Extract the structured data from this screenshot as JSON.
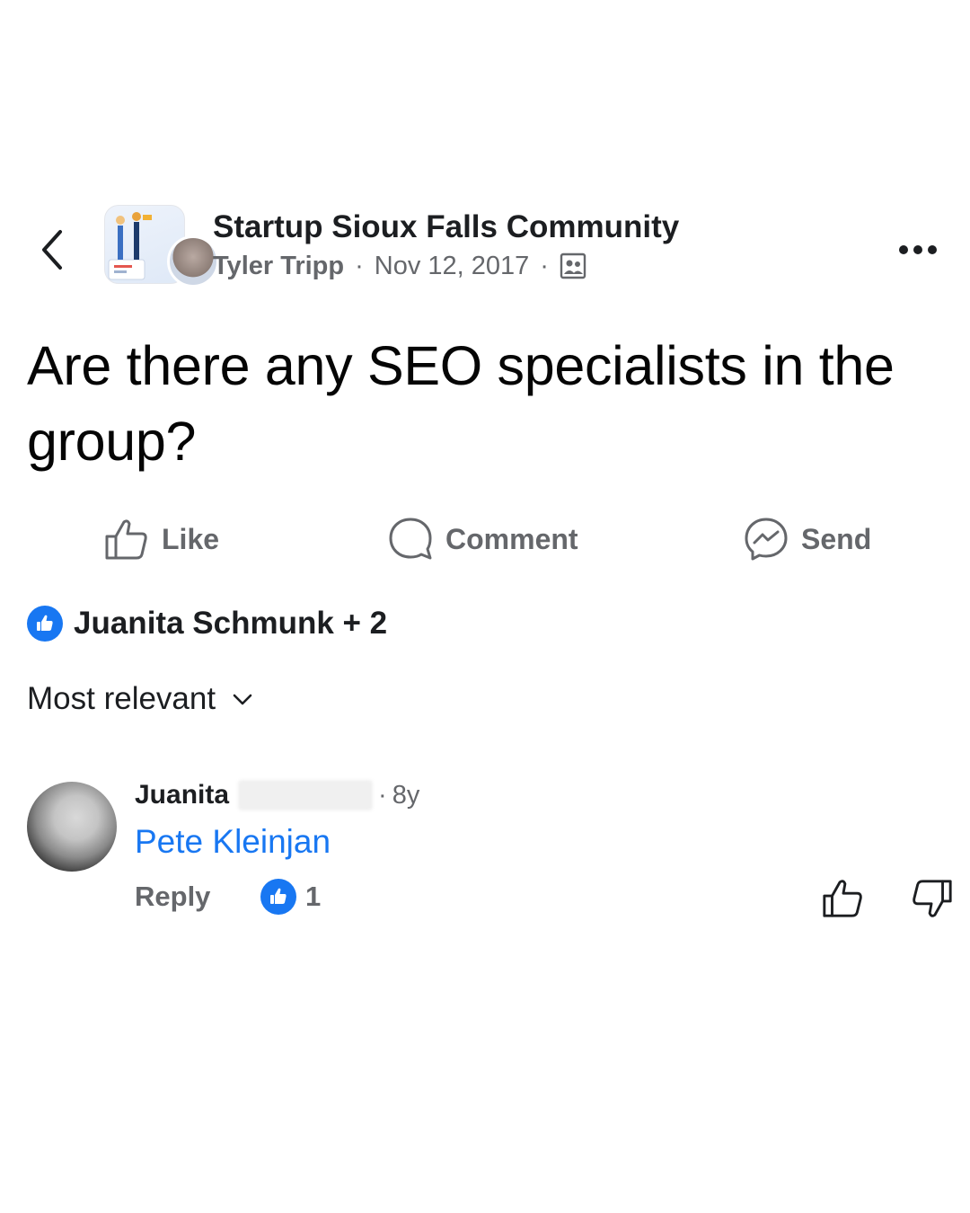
{
  "header": {
    "group_name": "Startup Sioux Falls Community",
    "author": "Tyler Tripp",
    "date": "Nov 12, 2017",
    "separator": "·"
  },
  "post": {
    "text": "Are there any SEO specialists in the group?"
  },
  "actions": {
    "like_label": "Like",
    "comment_label": "Comment",
    "send_label": "Send"
  },
  "reactions": {
    "summary": "Juanita Schmunk + 2"
  },
  "sort": {
    "label": "Most relevant"
  },
  "comment": {
    "author_visible": "Juanita",
    "separator": "·",
    "age": "8y",
    "mention": "Pete Kleinjan",
    "reply_label": "Reply",
    "like_count": "1"
  },
  "colors": {
    "brand_blue": "#1877f2",
    "secondary_text": "#65676b",
    "primary_text": "#1c1e21"
  },
  "icons": {
    "back": "chevron-left-icon",
    "more": "more-horizontal-icon",
    "audience": "members-only-icon",
    "like": "thumbs-up-outline-icon",
    "comment": "speech-bubble-icon",
    "send": "messenger-icon",
    "reaction": "like-reaction-icon",
    "sort": "chevron-down-icon",
    "upvote": "thumbs-up-outline-icon",
    "downvote": "thumbs-down-outline-icon"
  }
}
